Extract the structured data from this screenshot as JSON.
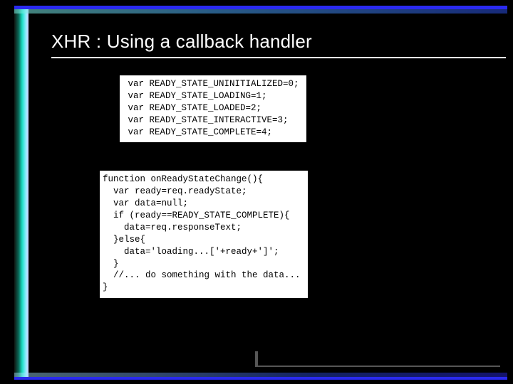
{
  "slide": {
    "title": "XHR : Using a callback handler"
  },
  "code_block_1": " var READY_STATE_UNINITIALIZED=0;\n var READY_STATE_LOADING=1;\n var READY_STATE_LOADED=2;\n var READY_STATE_INTERACTIVE=3;\n var READY_STATE_COMPLETE=4;",
  "code_block_2": "function onReadyStateChange(){\n  var ready=req.readyState;\n  var data=null;\n  if (ready==READY_STATE_COMPLETE){\n    data=req.responseText;\n  }else{\n    data='loading...['+ready+']';\n  }\n  //... do something with the data...\n}"
}
